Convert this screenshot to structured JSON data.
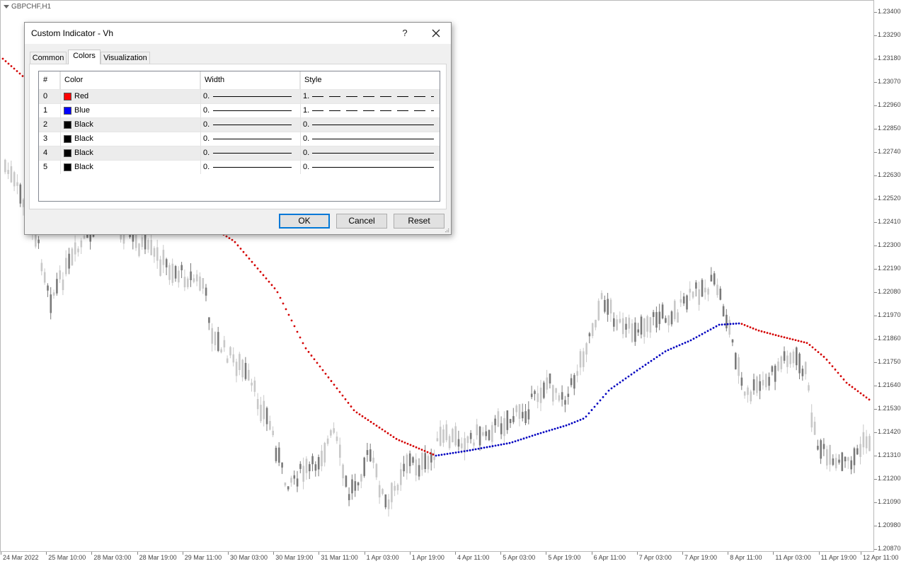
{
  "chart": {
    "symbol": "GBPCHF,H1",
    "price_labels": [
      "1.23400",
      "1.23290",
      "1.23180",
      "1.23070",
      "1.22960",
      "1.22850",
      "1.22740",
      "1.22630",
      "1.22520",
      "1.22410",
      "1.22300",
      "1.22190",
      "1.22080",
      "1.21970",
      "1.21860",
      "1.21750",
      "1.21640",
      "1.21530",
      "1.21420",
      "1.21310",
      "1.21200",
      "1.21090",
      "1.20980",
      "1.20870"
    ],
    "time_labels": [
      "24 Mar 2022",
      "25 Mar 10:00",
      "28 Mar 03:00",
      "28 Mar 19:00",
      "29 Mar 11:00",
      "30 Mar 03:00",
      "30 Mar 19:00",
      "31 Mar 11:00",
      "1 Apr 03:00",
      "1 Apr 19:00",
      "4 Apr 11:00",
      "5 Apr 03:00",
      "5 Apr 19:00",
      "6 Apr 11:00",
      "7 Apr 03:00",
      "7 Apr 19:00",
      "8 Apr 11:00",
      "11 Apr 03:00",
      "11 Apr 19:00",
      "12 Apr 11:00"
    ],
    "colors": {
      "down_trend": "#d40000",
      "up_trend": "#0000c0",
      "candles_light": "#c8c8c8",
      "candles_dark": "#7a7a7a"
    }
  },
  "dialog": {
    "title": "Custom Indicator - Vh",
    "help_label": "?",
    "tabs": [
      {
        "label": "Common",
        "active": false
      },
      {
        "label": "Colors",
        "active": true
      },
      {
        "label": "Visualization",
        "active": false
      }
    ],
    "grid": {
      "headers": {
        "index": "#",
        "color": "Color",
        "width": "Width",
        "style": "Style"
      },
      "rows": [
        {
          "index": "0",
          "color_name": "Red",
          "color": "#ff0000",
          "width": "0.",
          "style": "1.",
          "dashed": true
        },
        {
          "index": "1",
          "color_name": "Blue",
          "color": "#0000ff",
          "width": "0.",
          "style": "1.",
          "dashed": true
        },
        {
          "index": "2",
          "color_name": "Black",
          "color": "#000000",
          "width": "0.",
          "style": "0.",
          "dashed": false
        },
        {
          "index": "3",
          "color_name": "Black",
          "color": "#000000",
          "width": "0.",
          "style": "0.",
          "dashed": false
        },
        {
          "index": "4",
          "color_name": "Black",
          "color": "#000000",
          "width": "0.",
          "style": "0.",
          "dashed": false
        },
        {
          "index": "5",
          "color_name": "Black",
          "color": "#000000",
          "width": "0.",
          "style": "0.",
          "dashed": false
        }
      ]
    },
    "buttons": {
      "ok": "OK",
      "cancel": "Cancel",
      "reset": "Reset"
    }
  }
}
